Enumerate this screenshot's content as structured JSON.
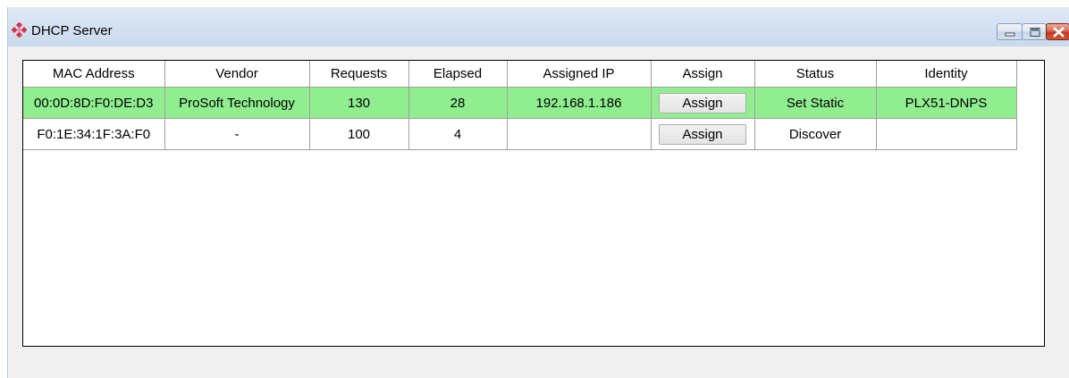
{
  "window": {
    "title": "DHCP Server",
    "icon": "red-diamond-cluster-icon",
    "controls": [
      "minimize-icon",
      "maximize-icon",
      "close-icon"
    ]
  },
  "table": {
    "columns": [
      "MAC Address",
      "Vendor",
      "Requests",
      "Elapsed",
      "Assigned IP",
      "Assign",
      "Status",
      "Identity"
    ],
    "rows": [
      {
        "mac": "00:0D:8D:F0:DE:D3",
        "vendor": "ProSoft Technology",
        "requests": "130",
        "elapsed": "28",
        "assigned_ip": "192.168.1.186",
        "assign_label": "Assign",
        "status": "Set Static",
        "identity": "PLX51-DNPS",
        "highlight": "#90ee90"
      },
      {
        "mac": "F0:1E:34:1F:3A:F0",
        "vendor": "-",
        "requests": "100",
        "elapsed": "4",
        "assigned_ip": "",
        "assign_label": "Assign",
        "status": "Discover",
        "identity": ""
      }
    ]
  }
}
